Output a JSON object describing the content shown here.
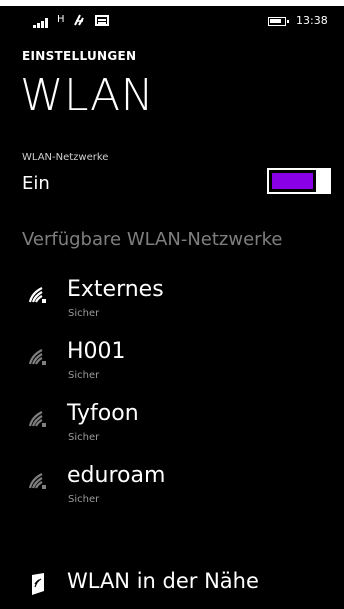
{
  "status_bar": {
    "network_type": "H",
    "time": "13:38",
    "icons": [
      "signal-icon",
      "wifi-status-icon",
      "message-icon",
      "battery-icon"
    ]
  },
  "header": {
    "app_title": "EINSTELLUNGEN",
    "page_title": "WLAN"
  },
  "wifi_toggle": {
    "label": "WLAN-Netzwerke",
    "value": "Ein",
    "on": true,
    "accent": "#8a00e6"
  },
  "networks": {
    "header": "Verfügbare WLAN-Netzwerke",
    "items": [
      {
        "name": "Externes",
        "security": "Sicher",
        "icon": "wifi-icon",
        "strength": "strong"
      },
      {
        "name": "H001",
        "security": "Sicher",
        "icon": "wifi-icon",
        "strength": "weak"
      },
      {
        "name": "Tyfoon",
        "security": "Sicher",
        "icon": "wifi-icon",
        "strength": "weak"
      },
      {
        "name": "eduroam",
        "security": "Sicher",
        "icon": "wifi-icon",
        "strength": "weak"
      }
    ]
  },
  "nearby": {
    "label": "WLAN in der Nähe",
    "icon": "map-icon"
  },
  "colors": {
    "background": "#000000",
    "text": "#ffffff",
    "secondary": "#7f7f7f",
    "wifi_strong": "#ffffff",
    "wifi_weak": "#7f7f7f"
  }
}
